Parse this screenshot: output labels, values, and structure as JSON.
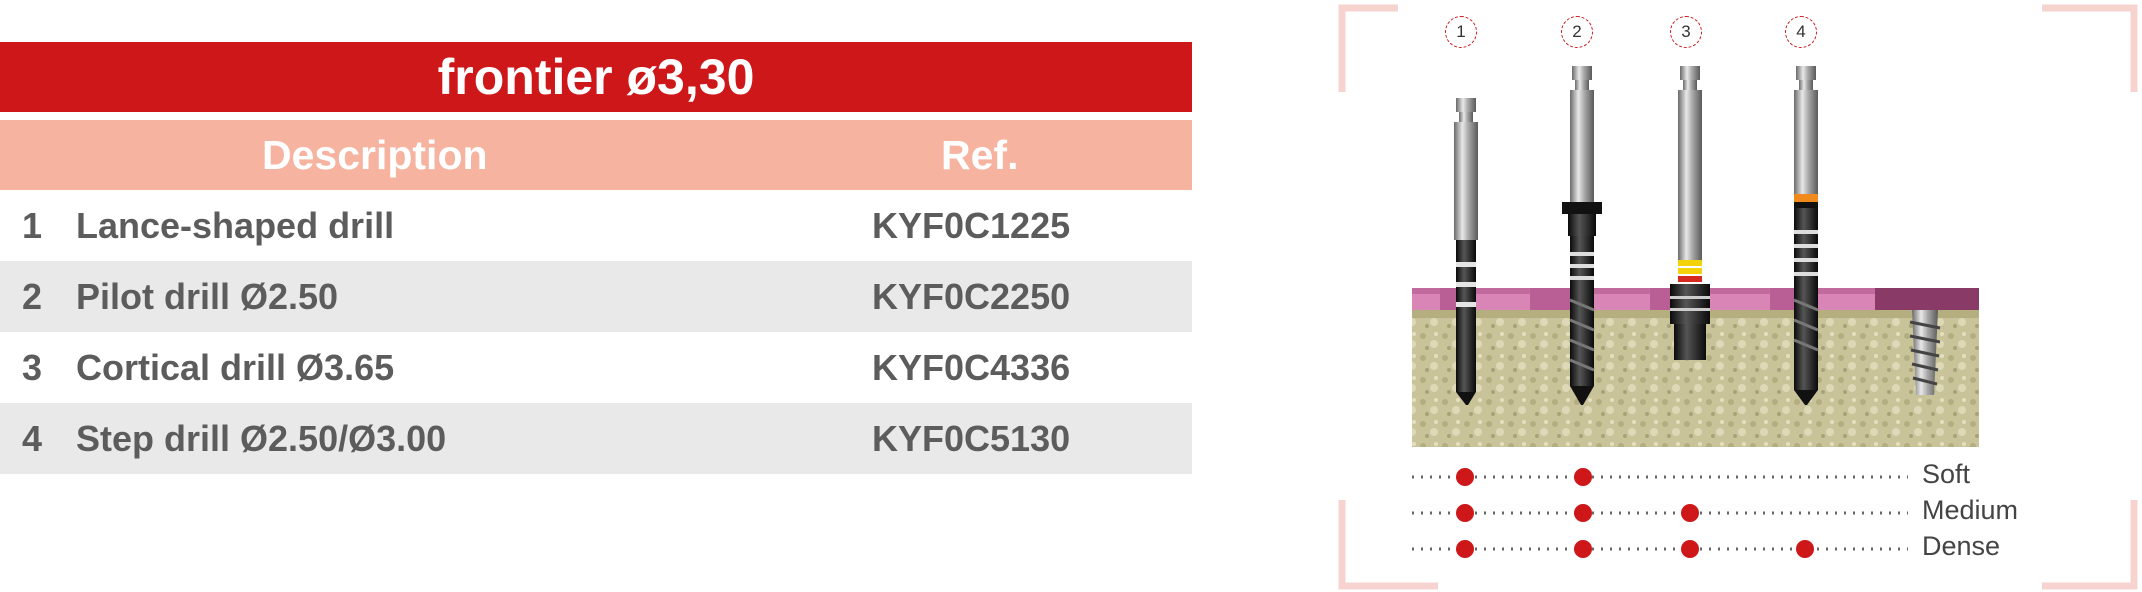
{
  "table": {
    "title": "frontier ø3,30",
    "header": {
      "description": "Description",
      "ref": "Ref."
    },
    "rows": [
      {
        "num": "1",
        "description": "Lance-shaped drill",
        "ref": "KYF0C1225"
      },
      {
        "num": "2",
        "description": "Pilot drill Ø2.50",
        "ref": "KYF0C2250"
      },
      {
        "num": "3",
        "description": "Cortical drill Ø3.65",
        "ref": "KYF0C4336"
      },
      {
        "num": "4",
        "description": "Step drill Ø2.50/Ø3.00",
        "ref": "KYF0C5130"
      }
    ]
  },
  "figure": {
    "drill_numbers": [
      "1",
      "2",
      "3",
      "4"
    ],
    "bone_density_labels": [
      "Soft",
      "Medium",
      "Dense"
    ],
    "colors": {
      "title_red": "#cd1719",
      "header_salmon": "#f6b39f",
      "gum_pink": "#d986b6",
      "bone": "#c9c39a",
      "dot_red": "#cd1719"
    }
  }
}
